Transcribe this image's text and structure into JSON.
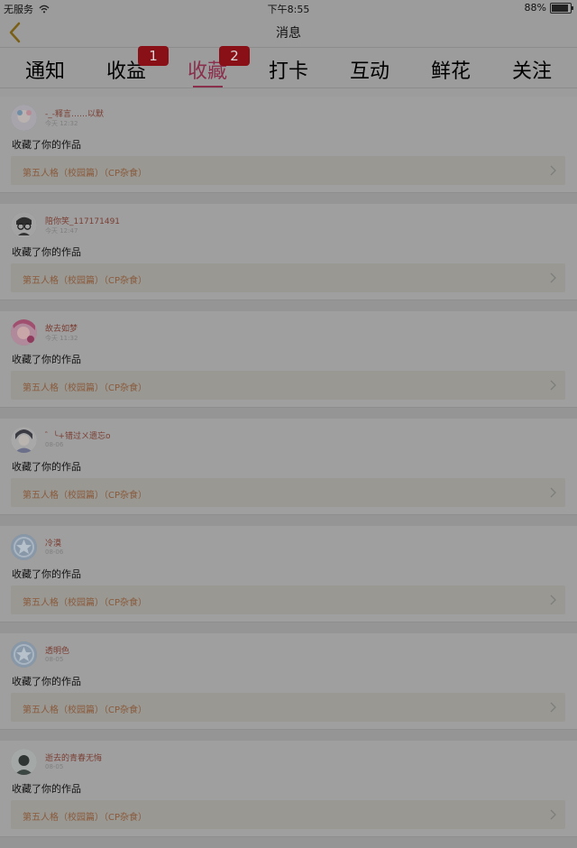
{
  "status_bar": {
    "carrier": "无服务",
    "time": "下午8:55",
    "battery": "88%",
    "battery_level": 0.88
  },
  "nav": {
    "title": "消息"
  },
  "tabs": [
    {
      "label": "通知",
      "badge": ""
    },
    {
      "label": "收益",
      "badge": "1"
    },
    {
      "label": "收藏",
      "badge": "2",
      "active": true
    },
    {
      "label": "打卡",
      "badge": ""
    },
    {
      "label": "互动",
      "badge": ""
    },
    {
      "label": "鲜花",
      "badge": ""
    },
    {
      "label": "关注",
      "badge": ""
    }
  ],
  "notifications": [
    {
      "user": "-_-释言……以默",
      "time": "今天 12:32",
      "action": "收藏了你的作品",
      "work": "第五人格（校园篇）（CP杂食）",
      "avatar": "avatar-pastel"
    },
    {
      "user": "陪你笑_117171491",
      "time": "今天 12:47",
      "action": "收藏了你的作品",
      "work": "第五人格（校园篇）（CP杂食）",
      "avatar": "avatar-glasses"
    },
    {
      "user": "故去如梦",
      "time": "今天 11:32",
      "action": "收藏了你的作品",
      "work": "第五人格（校园篇）（CP杂食）",
      "avatar": "avatar-pink"
    },
    {
      "user": "゛╰+错过ㄨ遗忘o",
      "time": "08-06",
      "action": "收藏了你的作品",
      "work": "第五人格（校园篇）（CP杂食）",
      "avatar": "avatar-dark"
    },
    {
      "user": "冷漠",
      "time": "08-06",
      "action": "收藏了你的作品",
      "work": "第五人格（校园篇）（CP杂食）",
      "avatar": "avatar-default-star"
    },
    {
      "user": "透明色",
      "time": "08-05",
      "action": "收藏了你的作品",
      "work": "第五人格（校园篇）（CP杂食）",
      "avatar": "avatar-default-star"
    },
    {
      "user": "逝去的青春无悔",
      "time": "08-05",
      "action": "收藏了你的作品",
      "work": "第五人格（校园篇）（CP杂食）",
      "avatar": "avatar-photo"
    }
  ]
}
